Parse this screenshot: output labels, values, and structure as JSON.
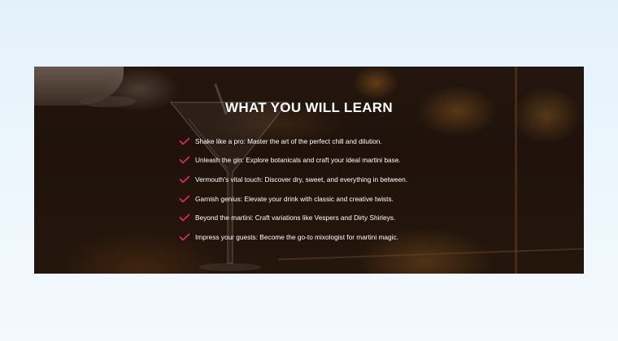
{
  "section": {
    "title": "WHAT YOU WILL LEARN",
    "accent_color": "#e0246b",
    "items": [
      {
        "text": "Shake like a pro: Master the art of the perfect chill and dilution.",
        "icon": "check-icon"
      },
      {
        "text": "Unleash the gin: Explore botanicals and craft your ideal martini base.",
        "icon": "check-icon"
      },
      {
        "text": "Vermouth's vital touch: Discover dry, sweet, and everything in between.",
        "icon": "check-icon"
      },
      {
        "text": "Garnish genius: Elevate your drink with classic and creative twists.",
        "icon": "check-icon"
      },
      {
        "text": "Beyond the martini: Craft variations like Vespers and Dirty Shirleys.",
        "icon": "check-icon"
      },
      {
        "text": "Impress your guests: Become the go-to mixologist for martini magic.",
        "icon": "check-icon"
      }
    ]
  }
}
